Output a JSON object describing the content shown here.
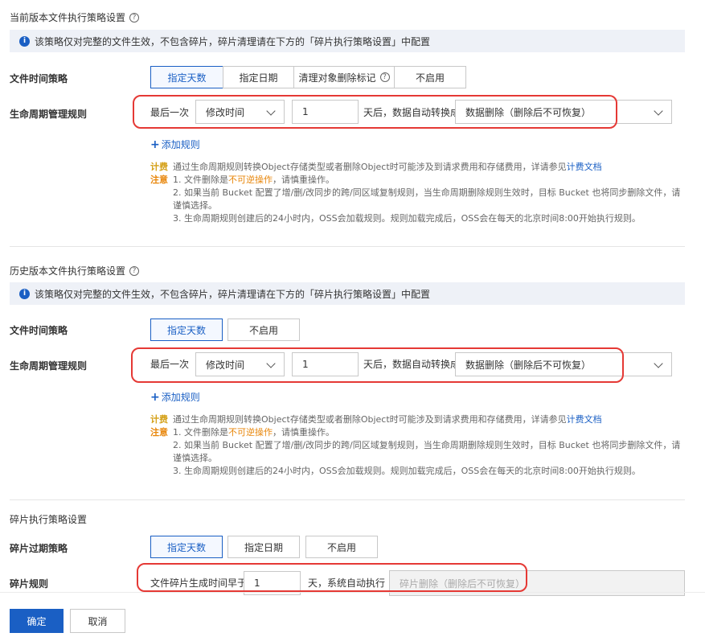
{
  "current": {
    "title": "当前版本文件执行策略设置",
    "info": "该策略仅对完整的文件生效，不包含碎片，碎片清理请在下方的「碎片执行策略设置」中配置",
    "time_policy_label": "文件时间策略",
    "tabs": [
      "指定天数",
      "指定日期",
      "清理对象删除标记",
      "不启用"
    ],
    "lifecycle_label": "生命周期管理规则",
    "rule": {
      "prefix": "最后一次",
      "time_type": "修改时间",
      "days": "1",
      "suffix": "天后，数据自动转换成",
      "action": "数据删除（删除后不可恢复）"
    },
    "add_rule": "添加规则"
  },
  "history": {
    "title": "历史版本文件执行策略设置",
    "info": "该策略仅对完整的文件生效，不包含碎片，碎片清理请在下方的「碎片执行策略设置」中配置",
    "time_policy_label": "文件时间策略",
    "tabs": [
      "指定天数",
      "不启用"
    ],
    "lifecycle_label": "生命周期管理规则",
    "rule": {
      "prefix": "最后一次",
      "time_type": "修改时间",
      "days": "1",
      "suffix": "天后，数据自动转换成",
      "action": "数据删除（删除后不可恢复）"
    },
    "add_rule": "添加规则"
  },
  "notes": {
    "billing_key": "计费",
    "billing_text": "通过生命周期规则转换Object存储类型或者删除Object时可能涉及到请求费用和存储费用，详请参见",
    "billing_link": "计费文档",
    "warn_key": "注意",
    "warn_1a": "1. 文件删除是",
    "warn_1b": "不可逆操作",
    "warn_1c": "，请慎重操作。",
    "warn_2": "2. 如果当前 Bucket 配置了增/删/改同步的跨/同区域复制规则，当生命周期删除规则生效时，目标 Bucket 也将同步删除文件，请谨慎选择。",
    "warn_3": "3. 生命周期规则创建后的24小时内，OSS会加载规则。规则加载完成后，OSS会在每天的北京时间8:00开始执行规则。"
  },
  "fragment": {
    "title": "碎片执行策略设置",
    "expire_label": "碎片过期策略",
    "tabs": [
      "指定天数",
      "指定日期",
      "不启用"
    ],
    "rule_label": "碎片规则",
    "rule_prefix": "文件碎片生成时间早于",
    "days": "1",
    "rule_suffix": "天，系统自动执行",
    "action": "碎片删除（删除后不可恢复）"
  },
  "footer": {
    "confirm": "确定",
    "cancel": "取消"
  },
  "colors": {
    "accent": "#1a5fc4",
    "highlight_box": "#e53935",
    "warn": "#e8860a"
  }
}
